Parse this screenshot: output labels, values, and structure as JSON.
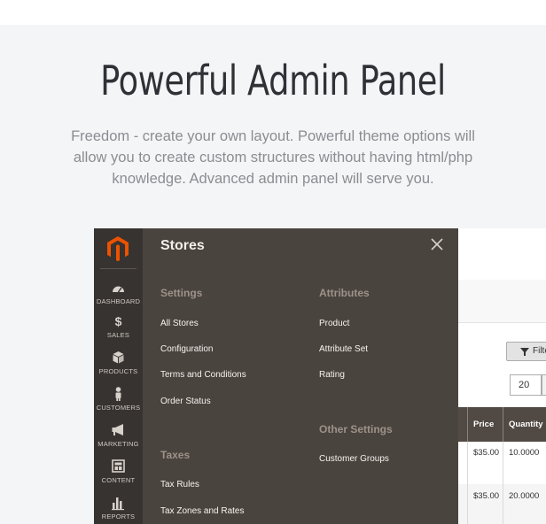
{
  "hero": {
    "title": "Powerful Admin Panel",
    "subtitle": "Freedom - create your own layout. Powerful theme options will allow you to create custom structures without having html/php knowledge. Advanced admin panel will serve you."
  },
  "colors": {
    "page_background": "#f4f5f7",
    "nav_background": "#373330",
    "menu_background": "#4a443f",
    "logo_accent": "#eb5202",
    "grid_header": "#514943"
  },
  "admin": {
    "logo_icon": "magento-logo-icon",
    "nav": [
      {
        "label": "DASHBOARD",
        "icon": "dashboard-gauge-icon"
      },
      {
        "label": "SALES",
        "icon": "dollar-icon"
      },
      {
        "label": "PRODUCTS",
        "icon": "cube-icon"
      },
      {
        "label": "CUSTOMERS",
        "icon": "person-icon"
      },
      {
        "label": "MARKETING",
        "icon": "megaphone-icon"
      },
      {
        "label": "CONTENT",
        "icon": "content-layout-icon"
      },
      {
        "label": "REPORTS",
        "icon": "bar-chart-icon"
      }
    ],
    "menu": {
      "title": "Stores",
      "close_icon": "close-icon",
      "settings_title": "Settings",
      "settings_items": [
        "All Stores",
        "Configuration",
        "Terms and Conditions",
        "Order Status"
      ],
      "taxes_title": "Taxes",
      "taxes_items": [
        "Tax Rules",
        "Tax Zones and Rates"
      ],
      "attributes_title": "Attributes",
      "attributes_items": [
        "Product",
        "Attribute Set",
        "Rating"
      ],
      "other_title": "Other Settings",
      "other_items": [
        "Customer Groups"
      ]
    },
    "grid": {
      "filters_label": "Filte",
      "filter_icon": "funnel-icon",
      "per_page": "20",
      "columns": [
        "Price",
        "Quantity"
      ],
      "rows": [
        {
          "price": "$35.00",
          "quantity": "10.0000"
        },
        {
          "price": "$35.00",
          "quantity": "20.0000"
        }
      ]
    }
  }
}
